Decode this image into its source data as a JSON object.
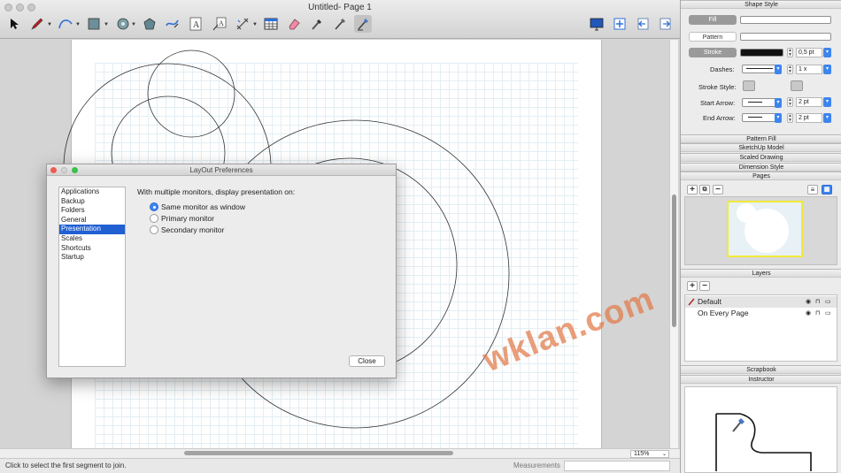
{
  "window": {
    "title": "Untitled- Page 1"
  },
  "status": {
    "hint": "Click to select the first segment to join.",
    "measurements_label": "Measurements",
    "measurements_value": "",
    "zoom": "115%"
  },
  "toolbar": {
    "tools": [
      "select-arrow-icon",
      "pencil-icon",
      "curve-icon",
      "rectangle-icon",
      "circle-icon",
      "polygon-icon",
      "freehand-icon",
      "text-icon",
      "label-icon",
      "dimension-icon",
      "table-icon",
      "eraser-icon",
      "eyedropper-icon",
      "style-brush-icon",
      "join-tool-icon"
    ],
    "right": [
      "presentation-icon",
      "add-page-icon",
      "previous-page-icon",
      "next-page-icon"
    ]
  },
  "preferences": {
    "title": "LayOut Preferences",
    "categories": [
      "Applications",
      "Backup",
      "Folders",
      "General",
      "Presentation",
      "Scales",
      "Shortcuts",
      "Startup"
    ],
    "selected_category": "Presentation",
    "heading": "With multiple monitors, display presentation on:",
    "options": [
      "Same monitor as window",
      "Primary monitor",
      "Secondary monitor"
    ],
    "selected_option": "Same monitor as window",
    "close_label": "Close"
  },
  "inspector": {
    "shape_style": {
      "title": "Shape Style",
      "fill_label": "Fill",
      "pattern_label": "Pattern",
      "stroke_label": "Stroke",
      "stroke_width": "0,5 pt",
      "dashes_label": "Dashes:",
      "dash_scale": "1 x",
      "stroke_style_label": "Stroke Style:",
      "start_arrow_label": "Start Arrow:",
      "start_arrow_size": "2 pt",
      "end_arrow_label": "End Arrow:",
      "end_arrow_size": "2 pt"
    },
    "panels": [
      "Pattern Fill",
      "SketchUp Model",
      "Scaled Drawing",
      "Dimension Style"
    ],
    "pages": {
      "title": "Pages"
    },
    "layers": {
      "title": "Layers",
      "items": [
        "Default",
        "On Every Page"
      ]
    },
    "scrapbook": {
      "title": "Scrapbook"
    },
    "instructor": {
      "title": "Instructor"
    }
  },
  "watermark": "wklan.com",
  "colors": {
    "accent": "#2160d3",
    "radio_on": "#3b86f1",
    "watermark": "#e27846",
    "thumb_border": "#f0ea3a"
  }
}
